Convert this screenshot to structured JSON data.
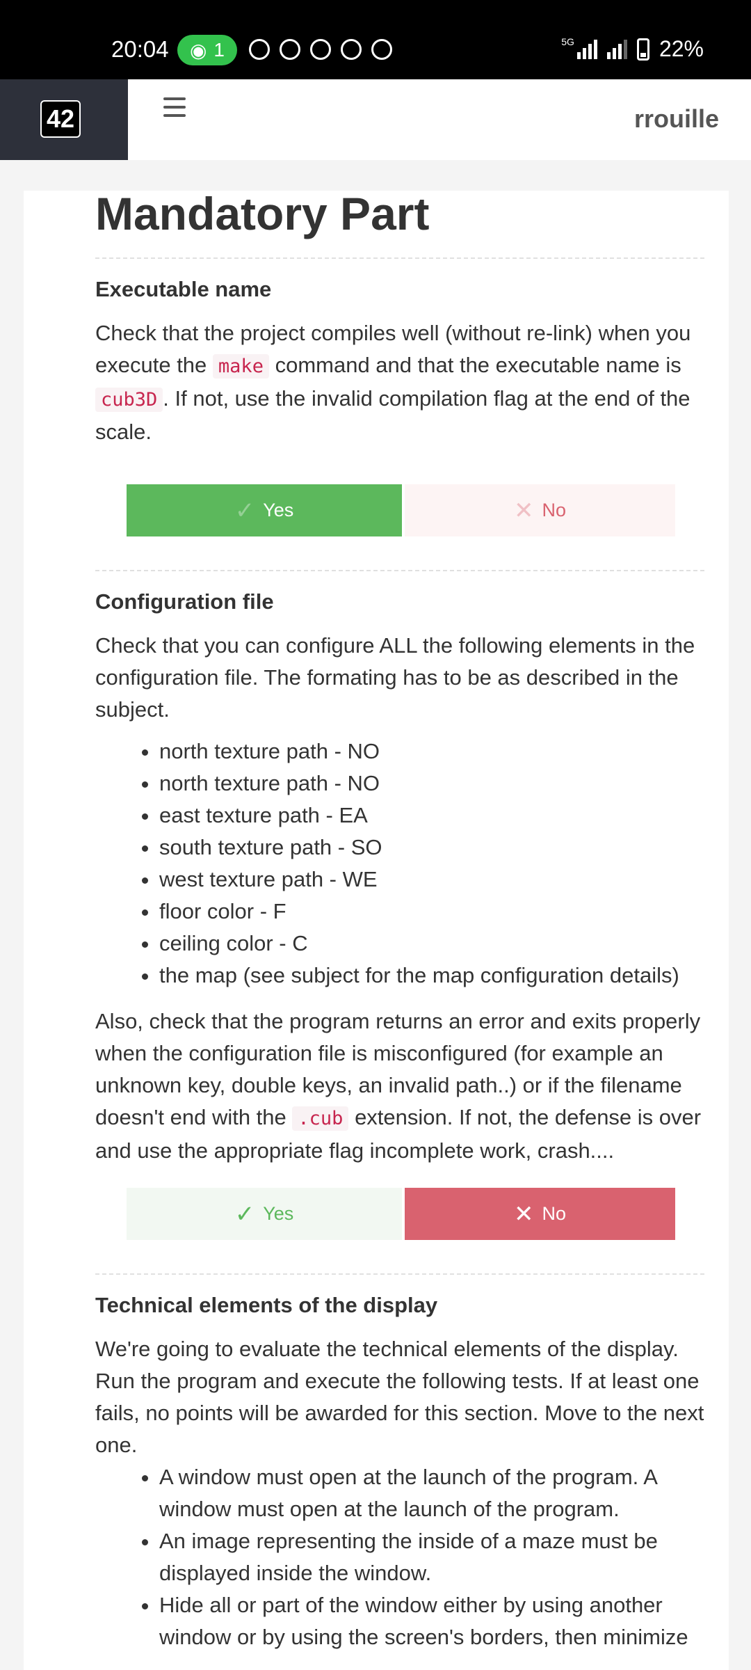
{
  "status_bar": {
    "time": "20:04",
    "hotspot_count": "1",
    "network": "5G",
    "battery": "22%",
    "notification_icons": [
      "chat-bubble-icon",
      "telegram-icon",
      "missed-call-icon",
      "app-icon",
      "mail-icon"
    ]
  },
  "header": {
    "logo": "42",
    "username": "rrouille"
  },
  "page": {
    "title": "Mandatory Part",
    "sections": [
      {
        "heading": "Executable name",
        "text_before_make": "Check that the project compiles well (without re-link) when you execute the",
        "code_make": "make",
        "text_between": "command and that the executable name is",
        "code_cub3d": "cub3D",
        "text_after": ". If not, use the invalid compilation flag at the end of the scale.",
        "yes_label": "Yes",
        "no_label": "No",
        "selected": "yes"
      },
      {
        "heading": "Configuration file",
        "intro": "Check that you can configure ALL the following elements in the configuration file. The formating has to be as described in the subject.",
        "items": [
          "north texture path - NO",
          "north texture path - NO",
          "east texture path - EA",
          "south texture path - SO",
          "west texture path - WE",
          "floor color - F",
          "ceiling color - C",
          "the map (see subject for the map configuration details)"
        ],
        "also_before": "Also, check that the program returns an error and exits properly when the configuration file is misconfigured (for example an unknown key, double keys, an invalid path..) or if the filename doesn't end with the",
        "code_cub": ".cub",
        "also_after": "extension. If not, the defense is over and use the appropriate flag incomplete work, crash....",
        "yes_label": "Yes",
        "no_label": "No",
        "selected": "no"
      },
      {
        "heading": "Technical elements of the display",
        "intro": "We're going to evaluate the technical elements of the display. Run the program and execute the following tests. If at least one fails, no points will be awarded for this section. Move to the next one.",
        "items": [
          "A window must open at the launch of the program. A window must open at the launch of the program.",
          "An image representing the inside of a maze must be displayed inside the window.",
          "Hide all or part of the window either by using another window or by using the screen's borders, then minimize"
        ]
      }
    ]
  },
  "colors": {
    "yes_green": "#5cb85c",
    "no_red": "#d9626f",
    "code_red": "#c7254e"
  }
}
